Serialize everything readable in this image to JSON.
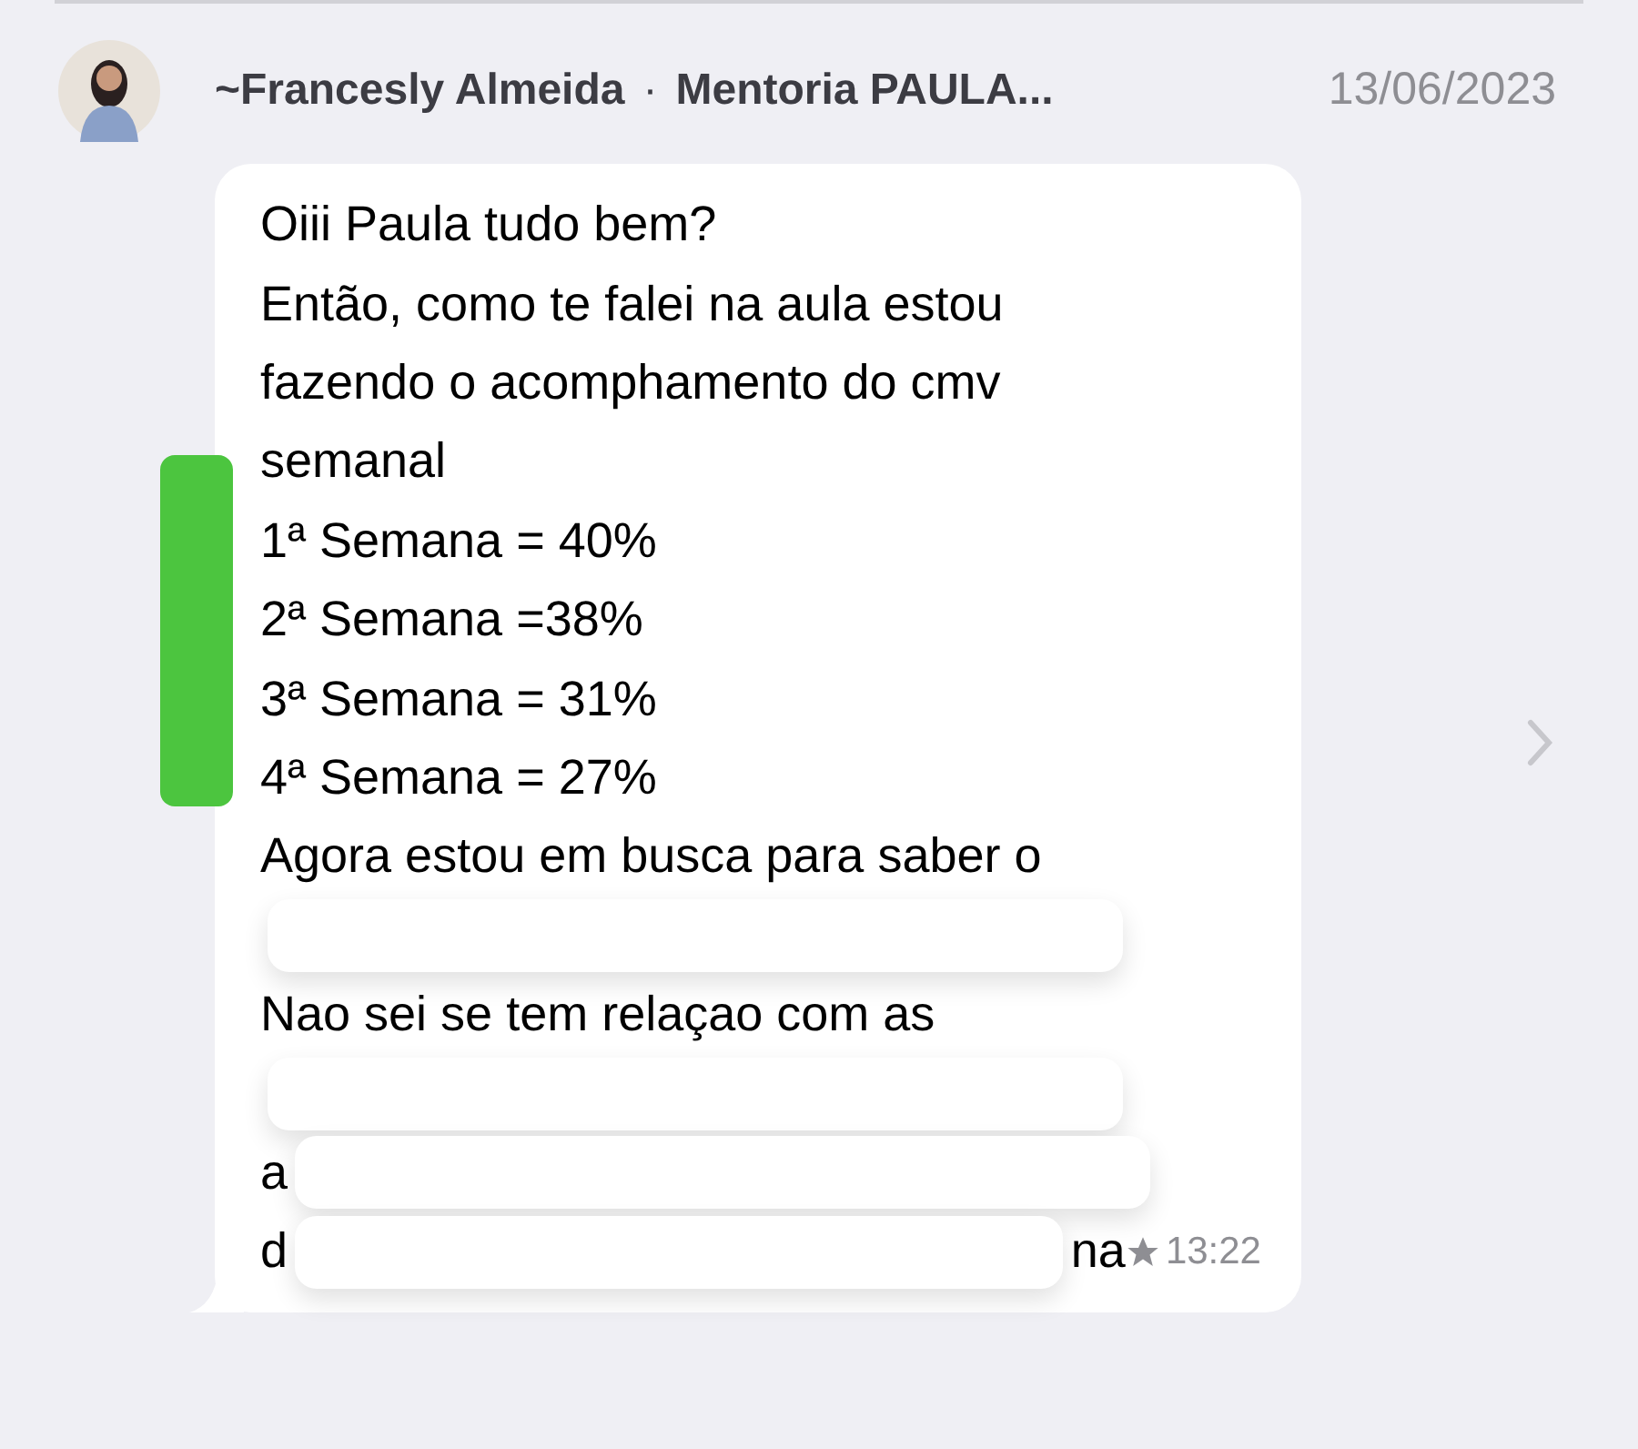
{
  "header": {
    "sender": "~Francesly Almeida",
    "separator": "·",
    "group": "Mentoria PAULA...",
    "date": "13/06/2023"
  },
  "message": {
    "lines": [
      {
        "text": "Oiii Paula tudo bem?",
        "redacted": false
      },
      {
        "text": "Então, como te falei na aula estou",
        "redacted": false
      },
      {
        "text": "fazendo o acomphamento do cmv",
        "redacted": false
      },
      {
        "text": "semanal",
        "redacted": false
      },
      {
        "text": "1ª Semana = 40%",
        "redacted": false
      },
      {
        "text": "2ª Semana =38%",
        "redacted": false
      },
      {
        "text": "3ª Semana = 31%",
        "redacted": false
      },
      {
        "text": "4ª Semana = 27%",
        "redacted": false
      },
      {
        "text": "Agora estou em busca para saber o",
        "redacted": false
      },
      {
        "redacted": true
      },
      {
        "text": "Nao sei se tem relaçao com as",
        "redacted": false
      },
      {
        "redacted": true
      },
      {
        "text": "a",
        "redacted": true
      },
      {
        "text": "d",
        "end": "na",
        "redacted": true
      }
    ],
    "starred": true,
    "time": "13:22",
    "highlighted": true
  }
}
